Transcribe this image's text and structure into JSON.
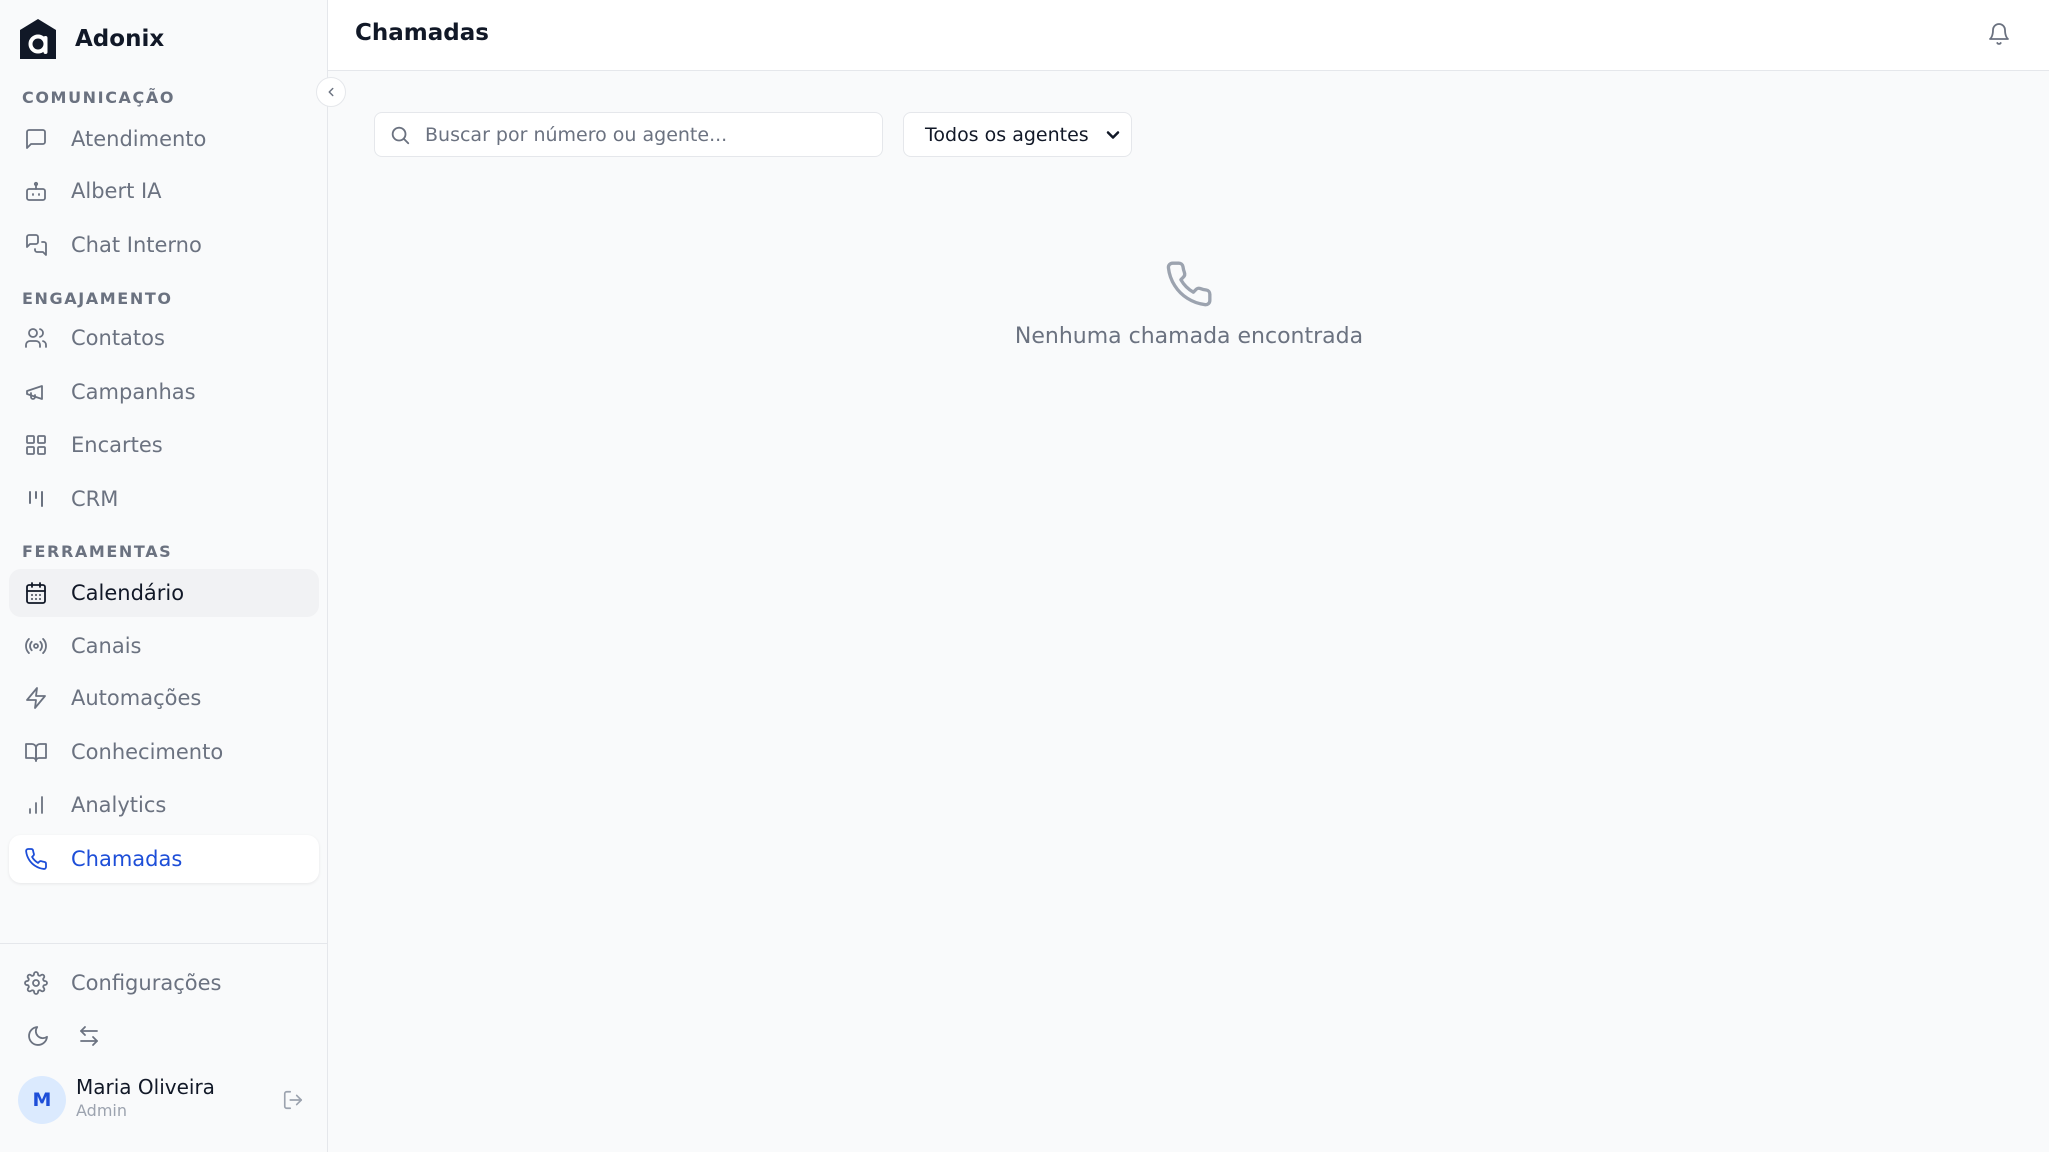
{
  "brand": {
    "name": "Adonix"
  },
  "sidebar": {
    "sections": [
      {
        "label": "COMUNICAÇÃO"
      },
      {
        "label": "ENGAJAMENTO"
      },
      {
        "label": "FERRAMENTAS"
      }
    ],
    "items": [
      {
        "label": "Atendimento",
        "icon": "message-square-icon"
      },
      {
        "label": "Albert IA",
        "icon": "bot-icon"
      },
      {
        "label": "Chat Interno",
        "icon": "messages-icon"
      },
      {
        "label": "Contatos",
        "icon": "users-icon"
      },
      {
        "label": "Campanhas",
        "icon": "megaphone-icon"
      },
      {
        "label": "Encartes",
        "icon": "grid-icon"
      },
      {
        "label": "CRM",
        "icon": "kanban-icon"
      },
      {
        "label": "Calendário",
        "icon": "calendar-icon",
        "state": "hovered"
      },
      {
        "label": "Canais",
        "icon": "radio-icon"
      },
      {
        "label": "Automações",
        "icon": "zap-icon"
      },
      {
        "label": "Conhecimento",
        "icon": "book-open-icon"
      },
      {
        "label": "Analytics",
        "icon": "bar-chart-icon"
      },
      {
        "label": "Chamadas",
        "icon": "phone-icon",
        "state": "active"
      }
    ],
    "settings": {
      "label": "Configurações",
      "icon": "gear-icon"
    },
    "user": {
      "initial": "M",
      "name": "Maria Oliveira",
      "role": "Admin"
    }
  },
  "header": {
    "title": "Chamadas"
  },
  "filters": {
    "search_placeholder": "Buscar por número ou agente...",
    "search_value": "",
    "agent_select": {
      "selected": "Todos os agentes"
    }
  },
  "empty_state": {
    "message": "Nenhuma chamada encontrada"
  },
  "colors": {
    "active": "#1d4ed8",
    "muted_text": "#6b7280",
    "border": "#e5e7eb",
    "background": "#f9fafb"
  }
}
